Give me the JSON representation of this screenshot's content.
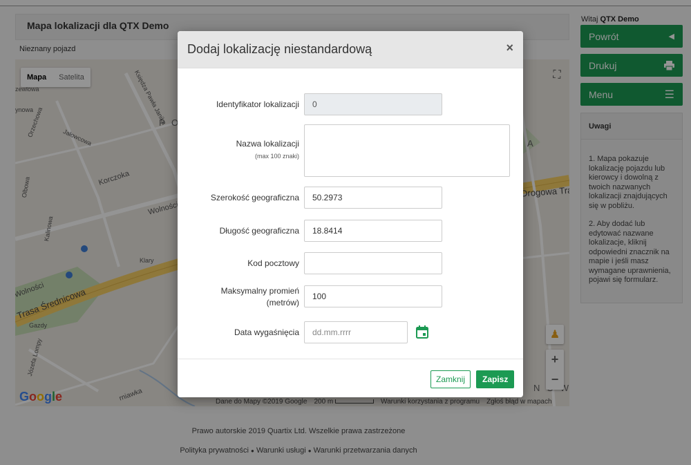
{
  "page": {
    "title": "Mapa lokalizacji dla QTX Demo",
    "vehicle": "Nieznany pojazd"
  },
  "map": {
    "type_map": "Mapa",
    "type_satellite": "Satelita",
    "google": "Google",
    "attribution": "Dane do Mapy ©2019 Google",
    "scale": "200 m",
    "terms": "Warunki korzystania z programu",
    "report": "Zgłoś błąd w mapach",
    "labels": {
      "korczoka": "Korczoka",
      "wolnosci": "Wolności",
      "wolnosci2": "Wolności",
      "trasa": "Trasa Średnicowa",
      "drogowa": "Drogowa Tra",
      "po": "P O",
      "a": "A",
      "nowy": "N O W Y",
      "kalinowa": "Kalinowa",
      "klary": "Klary",
      "orzechowa": "Orzechowa",
      "gazdy": "Gazdy",
      "ywiakowa": "rniawka",
      "jozefa": "Józefa Lompy",
      "ksiedza": "Księdza Pawła Janika",
      "olbowa": "Olbowa",
      "jalowcowa": "Jałowcowa",
      "zewlowa": "zewlowa",
      "ynowa": "ynowa"
    }
  },
  "sidebar": {
    "welcome_prefix": "Witaj",
    "welcome_user": "QTX Demo",
    "back": "Powrót",
    "print": "Drukuj",
    "menu": "Menu",
    "notes_title": "Uwagi",
    "note1": "1. Mapa pokazuje lokalizację pojazdu lub kierowcy i dowolną z twoich nazwanych lokalizacji znajdujących się w pobliżu.",
    "note2": "2. Aby dodać lub edytować nazwane lokalizacje, kliknij odpowiedni znacznik na mapie i jeśli masz wymagane uprawnienia, pojawi się formularz."
  },
  "footer": {
    "copyright": "Prawo autorskie 2019 Quartix Ltd. Wszelkie prawa zastrzeżone",
    "privacy": "Polityka prywatności",
    "terms": "Warunki usługi",
    "processing": "Warunki przetwarzania danych"
  },
  "modal": {
    "title": "Dodaj lokalizację niestandardową",
    "close_symbol": "×",
    "fields": {
      "id_label": "Identyfikator lokalizacji",
      "id_value": "0",
      "name_label": "Nazwa lokalizacji",
      "name_hint": "(max 100 znaki)",
      "name_value": "",
      "lat_label": "Szerokość geograficzna",
      "lat_value": "50.2973",
      "lng_label": "Długość geograficzna",
      "lng_value": "18.8414",
      "postcode_label": "Kod pocztowy",
      "postcode_value": "",
      "radius_label_1": "Maksymalny promień",
      "radius_label_2": "(metrów)",
      "radius_value": "100",
      "expiry_label": "Data wygaśnięcia",
      "expiry_placeholder": "dd.mm.rrrr"
    },
    "btn_close": "Zamknij",
    "btn_save": "Zapisz"
  },
  "colors": {
    "accent": "#1c9a53",
    "overlay": "rgba(0,0,0,0.42)"
  }
}
